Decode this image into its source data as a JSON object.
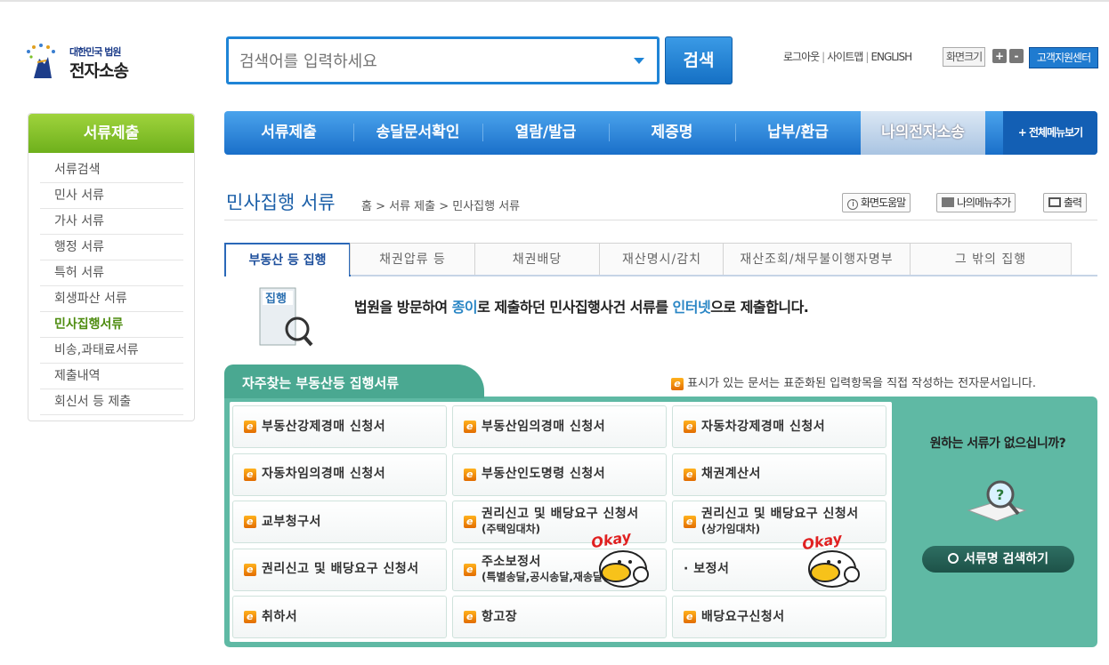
{
  "logo": {
    "line1": "대한민국 법원",
    "line2": "전자소송"
  },
  "search": {
    "placeholder": "검색어를 입력하세요",
    "button": "검색"
  },
  "toplinks": {
    "logout": "로그아웃",
    "sitemap": "사이트맵",
    "english": "ENGLISH",
    "zoom_label": "화면크기",
    "zoom_in": "+",
    "zoom_out": "-",
    "support": "고객지원센터"
  },
  "sidebar": {
    "title": "서류제출",
    "items": [
      "서류검색",
      "민사 서류",
      "가사 서류",
      "행정 서류",
      "특허 서류",
      "회생파산 서류",
      "민사집행서류",
      "비송,과태료서류",
      "제출내역",
      "회신서 등 제출"
    ],
    "active_index": 6
  },
  "gnb": {
    "items": [
      "서류제출",
      "송달문서확인",
      "열람/발급",
      "제증명",
      "납부/환급",
      "나의전자소송"
    ],
    "active_index": 5,
    "all_menu": "+ 전체메뉴보기"
  },
  "page": {
    "title": "민사집행 서류",
    "breadcrumb": "홈 > 서류 제출 > 민사집행 서류",
    "help": "화면도움말",
    "add_menu": "나의메뉴추가",
    "print": "출력"
  },
  "tabs": [
    "부동산 등 집행",
    "채권압류 등",
    "채권배당",
    "재산명시/감치",
    "재산조회/채무불이행자명부",
    "그 밖의 집행"
  ],
  "active_tab": 0,
  "intro": {
    "icon_label": "집행",
    "p1": "법원을 방문하여 ",
    "h1": "종이",
    "p2": "로 제출하던 민사집행사건 서류를 ",
    "h2": "인터넷",
    "p3": "으로 제출합니다."
  },
  "panel": {
    "title": "자주찾는 부동산등 집행서류",
    "note": "표시가 있는 문서는 표준화된 입력항목을 직접 작성하는 전자문서입니다.",
    "docs": [
      {
        "l1": "부동산강제경매 신청서",
        "l2": "",
        "e": true
      },
      {
        "l1": "부동산임의경매 신청서",
        "l2": "",
        "e": true
      },
      {
        "l1": "자동차강제경매 신청서",
        "l2": "",
        "e": true
      },
      {
        "l1": "자동차임의경매 신청서",
        "l2": "",
        "e": true
      },
      {
        "l1": "부동산인도명령 신청서",
        "l2": "",
        "e": true
      },
      {
        "l1": "채권계산서",
        "l2": "",
        "e": true
      },
      {
        "l1": "교부청구서",
        "l2": "",
        "e": true
      },
      {
        "l1": "권리신고 및 배당요구 신청서",
        "l2": "(주택임대차)",
        "e": true
      },
      {
        "l1": "권리신고 및 배당요구 신청서",
        "l2": "(상가임대차)",
        "e": true
      },
      {
        "l1": "권리신고 및 배당요구 신청서",
        "l2": "",
        "e": true
      },
      {
        "l1": "주소보정서",
        "l2": "(특별송달,공시송달,재송달신청)",
        "e": true
      },
      {
        "l1": "· 보정서",
        "l2": "",
        "e": false
      },
      {
        "l1": "취하서",
        "l2": "",
        "e": true
      },
      {
        "l1": "항고장",
        "l2": "",
        "e": true
      },
      {
        "l1": "배당요구신청서",
        "l2": "",
        "e": true
      }
    ],
    "question": "원하는 서류가 없으십니까?",
    "search_button": "서류명 검색하기"
  },
  "okay_text": "Okay",
  "colors": {
    "accent_blue": "#1e84d6",
    "green": "#7cc02a",
    "teal": "#5fb9a4",
    "highlight": "#2a86c5"
  }
}
